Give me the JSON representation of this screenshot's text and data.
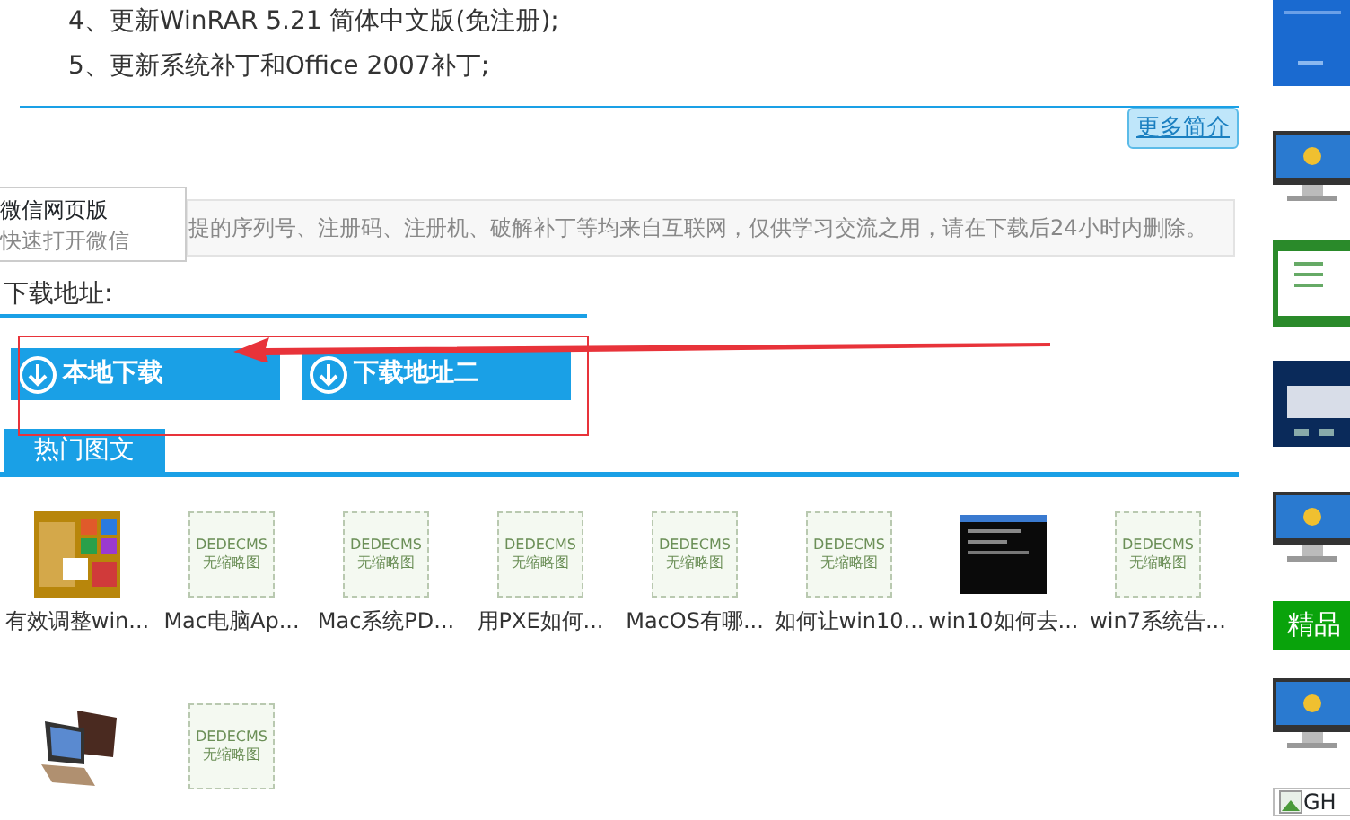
{
  "intro_lines": [
    "4、更新WinRAR 5.21 简体中文版(免注册);",
    "5、更新系统补丁和Office 2007补丁;"
  ],
  "more_button": "更多简介",
  "notice": "提的序列号、注册码、注册机、破解补丁等均来自互联网，仅供学习交流之用，请在下载后24小时内删除。",
  "popup": {
    "title": "微信网页版",
    "subtitle": "快速打开微信"
  },
  "download": {
    "heading": "下载地址:",
    "buttons": [
      "本地下载",
      "下载地址二"
    ]
  },
  "hot": {
    "tab": "热门图文",
    "items": [
      {
        "kind": "picture",
        "caption": "有效调整win..."
      },
      {
        "kind": "placeholder",
        "placeholder_lines": [
          "DEDECMS",
          "无缩略图"
        ],
        "caption": "Mac电脑Ap..."
      },
      {
        "kind": "placeholder",
        "placeholder_lines": [
          "DEDECMS",
          "无缩略图"
        ],
        "caption": "Mac系统PD..."
      },
      {
        "kind": "placeholder",
        "placeholder_lines": [
          "DEDECMS",
          "无缩略图"
        ],
        "caption": "用PXE如何..."
      },
      {
        "kind": "placeholder",
        "placeholder_lines": [
          "DEDECMS",
          "无缩略图"
        ],
        "caption": "MacOS有哪..."
      },
      {
        "kind": "placeholder",
        "placeholder_lines": [
          "DEDECMS",
          "无缩略图"
        ],
        "caption": "如何让win10..."
      },
      {
        "kind": "picture",
        "caption": "win10如何去..."
      },
      {
        "kind": "placeholder",
        "placeholder_lines": [
          "DEDECMS",
          "无缩略图"
        ],
        "caption": "win7系统告..."
      },
      {
        "kind": "picture"
      },
      {
        "kind": "placeholder",
        "placeholder_lines": [
          "DEDECMS",
          "无缩略图"
        ]
      }
    ]
  },
  "sidebar": [
    {
      "kind": "picture"
    },
    {
      "kind": "picture"
    },
    {
      "kind": "picture"
    },
    {
      "kind": "picture"
    },
    {
      "kind": "picture"
    },
    {
      "kind": "header",
      "label": "精品"
    },
    {
      "kind": "picture"
    },
    {
      "kind": "broken",
      "alt": "GH"
    }
  ]
}
